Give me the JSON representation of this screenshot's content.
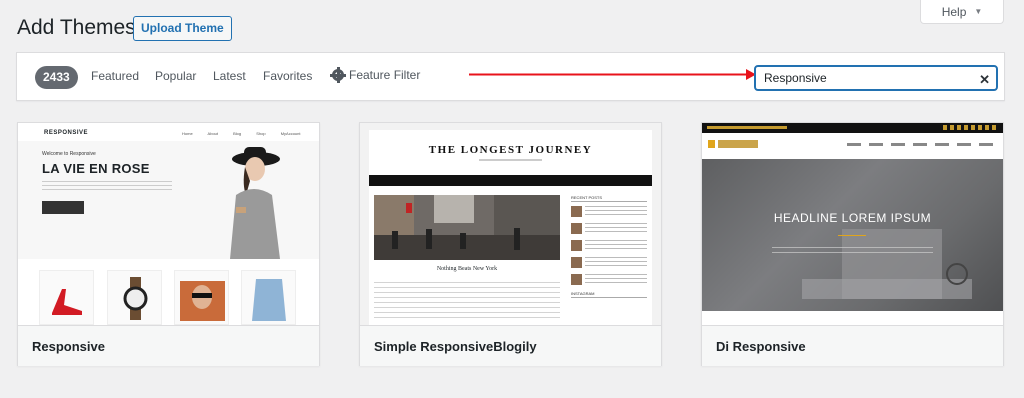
{
  "page": {
    "title": "Add Themes",
    "upload_label": "Upload Theme",
    "help_label": "Help"
  },
  "filters": {
    "count": "2433",
    "tabs": [
      "Featured",
      "Popular",
      "Latest",
      "Favorites"
    ],
    "feature_filter_label": "Feature Filter"
  },
  "search": {
    "value": "Responsive",
    "clear_icon": "close-icon"
  },
  "annotation": {
    "arrow_color": "#e8131b"
  },
  "themes": [
    {
      "name": "Responsive",
      "preview": {
        "site_title": "RESPONSIVE",
        "nav": "Home About Blog Shop MyAccount",
        "welcome": "Welcome to Responsive",
        "headline": "LA VIE EN ROSE"
      }
    },
    {
      "name": "Simple ResponsiveBlogily",
      "preview": {
        "site_title": "THE LONGEST JOURNEY",
        "post_title": "Nothing Beats New York",
        "sidebar_heading": "RECENT POSTS",
        "sidebar_heading_2": "INSTAGRAM"
      }
    },
    {
      "name": "Di Responsive",
      "preview": {
        "headline": "HEADLINE LOREM IPSUM"
      }
    }
  ]
}
